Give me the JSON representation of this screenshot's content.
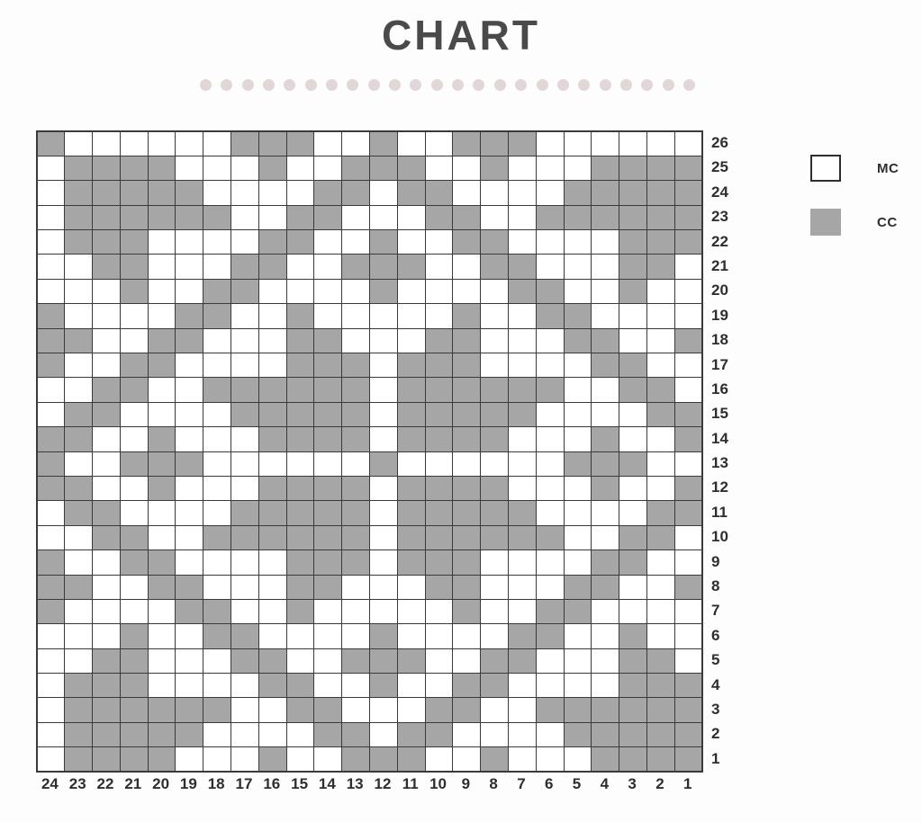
{
  "header": {
    "title": "CHART",
    "divider_dot_count": 24,
    "divider_dot_color": "#e2d7d7"
  },
  "legend": {
    "items": [
      {
        "key": "MC",
        "label": "MC",
        "color": "#ffffff",
        "swatch": "outlined-square"
      },
      {
        "key": "CC",
        "label": "CC",
        "color": "#a6a6a6",
        "swatch": "filled-square"
      }
    ]
  },
  "chart_data": {
    "type": "heatmap",
    "title": "CHART",
    "xlabel": "",
    "ylabel": "",
    "grid": true,
    "legend_position": "right",
    "colors": {
      "MC": "#ffffff",
      "CC": "#a6a6a6",
      "gridline": "#3a3a3a"
    },
    "columns": 24,
    "rows": 26,
    "column_labels": [
      "24",
      "23",
      "22",
      "21",
      "20",
      "19",
      "18",
      "17",
      "16",
      "15",
      "14",
      "13",
      "12",
      "11",
      "10",
      "9",
      "8",
      "7",
      "6",
      "5",
      "4",
      "3",
      "2",
      "1"
    ],
    "row_labels": [
      "26",
      "25",
      "24",
      "23",
      "22",
      "21",
      "20",
      "19",
      "18",
      "17",
      "16",
      "15",
      "14",
      "13",
      "12",
      "11",
      "10",
      "9",
      "8",
      "7",
      "6",
      "5",
      "4",
      "3",
      "2",
      "1"
    ],
    "cell_codes": {
      "0": "MC",
      "1": "CC"
    },
    "values": [
      [
        1,
        0,
        0,
        0,
        0,
        0,
        0,
        1,
        1,
        1,
        0,
        0,
        1,
        0,
        0,
        1,
        1,
        1,
        0,
        0,
        0,
        0,
        0,
        0
      ],
      [
        0,
        1,
        1,
        1,
        1,
        0,
        0,
        0,
        1,
        0,
        0,
        1,
        1,
        1,
        0,
        0,
        1,
        0,
        0,
        0,
        1,
        1,
        1,
        1
      ],
      [
        0,
        1,
        1,
        1,
        1,
        1,
        0,
        0,
        0,
        0,
        1,
        1,
        0,
        1,
        1,
        0,
        0,
        0,
        0,
        1,
        1,
        1,
        1,
        1
      ],
      [
        0,
        1,
        1,
        1,
        1,
        1,
        1,
        0,
        0,
        1,
        1,
        0,
        0,
        0,
        1,
        1,
        0,
        0,
        1,
        1,
        1,
        1,
        1,
        1
      ],
      [
        0,
        1,
        1,
        1,
        0,
        0,
        0,
        0,
        1,
        1,
        0,
        0,
        1,
        0,
        0,
        1,
        1,
        0,
        0,
        0,
        0,
        1,
        1,
        1
      ],
      [
        0,
        0,
        1,
        1,
        0,
        0,
        0,
        1,
        1,
        0,
        0,
        1,
        1,
        1,
        0,
        0,
        1,
        1,
        0,
        0,
        0,
        1,
        1,
        0
      ],
      [
        0,
        0,
        0,
        1,
        0,
        0,
        1,
        1,
        0,
        0,
        0,
        0,
        1,
        0,
        0,
        0,
        0,
        1,
        1,
        0,
        0,
        1,
        0,
        0
      ],
      [
        1,
        0,
        0,
        0,
        0,
        1,
        1,
        0,
        0,
        1,
        0,
        0,
        0,
        0,
        0,
        1,
        0,
        0,
        1,
        1,
        0,
        0,
        0,
        0
      ],
      [
        1,
        1,
        0,
        0,
        1,
        1,
        0,
        0,
        0,
        1,
        1,
        0,
        0,
        0,
        1,
        1,
        0,
        0,
        0,
        1,
        1,
        0,
        0,
        1
      ],
      [
        1,
        0,
        0,
        1,
        1,
        0,
        0,
        0,
        0,
        1,
        1,
        1,
        0,
        1,
        1,
        1,
        0,
        0,
        0,
        0,
        1,
        1,
        0,
        0
      ],
      [
        0,
        0,
        1,
        1,
        0,
        0,
        1,
        1,
        1,
        1,
        1,
        1,
        0,
        1,
        1,
        1,
        1,
        1,
        1,
        0,
        0,
        1,
        1,
        0
      ],
      [
        0,
        1,
        1,
        0,
        0,
        0,
        0,
        1,
        1,
        1,
        1,
        1,
        0,
        1,
        1,
        1,
        1,
        1,
        0,
        0,
        0,
        0,
        1,
        1
      ],
      [
        1,
        1,
        0,
        0,
        1,
        0,
        0,
        0,
        1,
        1,
        1,
        1,
        0,
        1,
        1,
        1,
        1,
        0,
        0,
        0,
        1,
        0,
        0,
        1
      ],
      [
        1,
        0,
        0,
        1,
        1,
        1,
        0,
        0,
        0,
        0,
        0,
        0,
        1,
        0,
        0,
        0,
        0,
        0,
        0,
        1,
        1,
        1,
        0,
        0
      ],
      [
        1,
        1,
        0,
        0,
        1,
        0,
        0,
        0,
        1,
        1,
        1,
        1,
        0,
        1,
        1,
        1,
        1,
        0,
        0,
        0,
        1,
        0,
        0,
        1
      ],
      [
        0,
        1,
        1,
        0,
        0,
        0,
        0,
        1,
        1,
        1,
        1,
        1,
        0,
        1,
        1,
        1,
        1,
        1,
        0,
        0,
        0,
        0,
        1,
        1
      ],
      [
        0,
        0,
        1,
        1,
        0,
        0,
        1,
        1,
        1,
        1,
        1,
        1,
        0,
        1,
        1,
        1,
        1,
        1,
        1,
        0,
        0,
        1,
        1,
        0
      ],
      [
        1,
        0,
        0,
        1,
        1,
        0,
        0,
        0,
        0,
        1,
        1,
        1,
        0,
        1,
        1,
        1,
        0,
        0,
        0,
        0,
        1,
        1,
        0,
        0
      ],
      [
        1,
        1,
        0,
        0,
        1,
        1,
        0,
        0,
        0,
        1,
        1,
        0,
        0,
        0,
        1,
        1,
        0,
        0,
        0,
        1,
        1,
        0,
        0,
        1
      ],
      [
        1,
        0,
        0,
        0,
        0,
        1,
        1,
        0,
        0,
        1,
        0,
        0,
        0,
        0,
        0,
        1,
        0,
        0,
        1,
        1,
        0,
        0,
        0,
        0
      ],
      [
        0,
        0,
        0,
        1,
        0,
        0,
        1,
        1,
        0,
        0,
        0,
        0,
        1,
        0,
        0,
        0,
        0,
        1,
        1,
        0,
        0,
        1,
        0,
        0
      ],
      [
        0,
        0,
        1,
        1,
        0,
        0,
        0,
        1,
        1,
        0,
        0,
        1,
        1,
        1,
        0,
        0,
        1,
        1,
        0,
        0,
        0,
        1,
        1,
        0
      ],
      [
        0,
        1,
        1,
        1,
        0,
        0,
        0,
        0,
        1,
        1,
        0,
        0,
        1,
        0,
        0,
        1,
        1,
        0,
        0,
        0,
        0,
        1,
        1,
        1
      ],
      [
        0,
        1,
        1,
        1,
        1,
        1,
        1,
        0,
        0,
        1,
        1,
        0,
        0,
        0,
        1,
        1,
        0,
        0,
        1,
        1,
        1,
        1,
        1,
        1
      ],
      [
        0,
        1,
        1,
        1,
        1,
        1,
        0,
        0,
        0,
        0,
        1,
        1,
        0,
        1,
        1,
        0,
        0,
        0,
        0,
        1,
        1,
        1,
        1,
        1
      ],
      [
        0,
        1,
        1,
        1,
        1,
        0,
        0,
        0,
        1,
        0,
        0,
        1,
        1,
        1,
        0,
        0,
        1,
        0,
        0,
        0,
        1,
        1,
        1,
        1
      ]
    ]
  }
}
